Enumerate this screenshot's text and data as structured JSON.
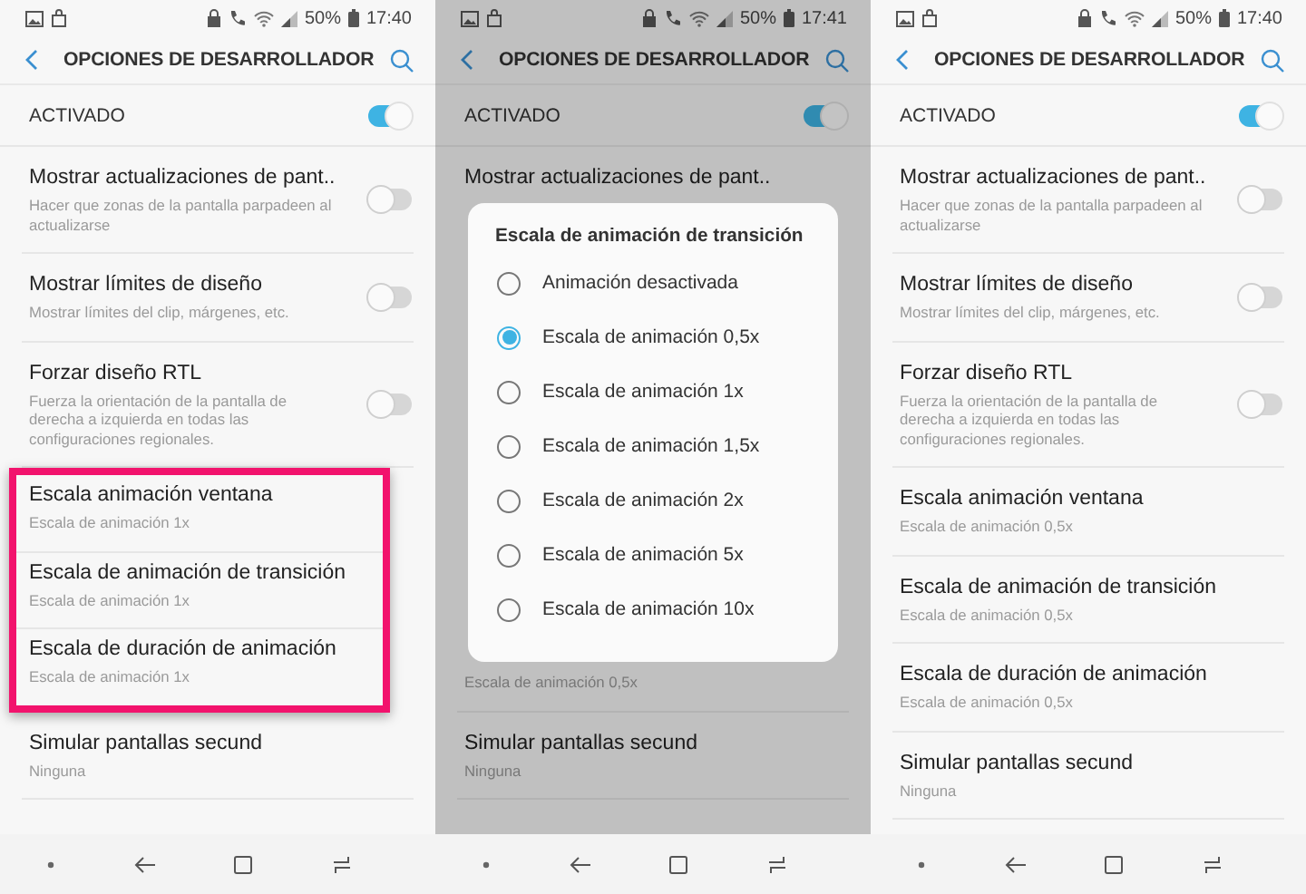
{
  "screens": [
    {
      "dimmed": false,
      "status_bar": {
        "battery": "50%",
        "time": "17:40"
      },
      "header": {
        "title": "OPCIONES DE DESARROLLADOR"
      },
      "master": {
        "label": "ACTIVADO",
        "on": true
      },
      "rows": [
        {
          "kind": "toggle",
          "title": "Mostrar actualizaciones de pant..",
          "subtitle": "Hacer que zonas de la pantalla parpadeen al actualizarse",
          "on": false,
          "highlighted": false
        },
        {
          "kind": "toggle",
          "title": "Mostrar límites de diseño",
          "subtitle": "Mostrar límites del clip, márgenes, etc.",
          "on": false,
          "highlighted": false
        },
        {
          "kind": "toggle",
          "title": "Forzar diseño RTL",
          "subtitle": "Fuerza la orientación de la pantalla de derecha a izquierda en todas las configuraciones regionales.",
          "on": false,
          "highlighted": false
        },
        {
          "kind": "text",
          "title": "Escala animación ventana",
          "subtitle": "Escala de animación 1x",
          "highlighted": true
        },
        {
          "kind": "text",
          "title": "Escala de animación de transición",
          "subtitle": "Escala de animación 1x",
          "highlighted": true
        },
        {
          "kind": "text",
          "title": "Escala de duración de animación",
          "subtitle": "Escala de animación 1x",
          "highlighted": true
        },
        {
          "kind": "text",
          "title": "Simular pantallas secund",
          "subtitle": "Ninguna",
          "highlighted": false
        }
      ]
    },
    {
      "dimmed": true,
      "status_bar": {
        "battery": "50%",
        "time": "17:41"
      },
      "header": {
        "title": "OPCIONES DE DESARROLLADOR"
      },
      "master": {
        "label": "ACTIVADO",
        "on": true
      },
      "rows": [
        {
          "title": "Mostrar actualizaciones de pant..",
          "highlighted": false
        }
      ],
      "dialog": {
        "title": "Escala de animación de transición",
        "options": [
          {
            "label": "Animación desactivada",
            "selected": false
          },
          {
            "label": "Escala de animación 0,5x",
            "selected": true
          },
          {
            "label": "Escala de animación 1x",
            "selected": false
          },
          {
            "label": "Escala de animación 1,5x",
            "selected": false
          },
          {
            "label": "Escala de animación 2x",
            "selected": false
          },
          {
            "label": "Escala de animación 5x",
            "selected": false
          },
          {
            "label": "Escala de animación 10x",
            "selected": false
          }
        ]
      },
      "rows_below": [
        {
          "subtitle": "Escala de animación 0,5x",
          "highlighted": false
        },
        {
          "title": "Simular pantallas secund",
          "subtitle": "Ninguna",
          "highlighted": false
        }
      ]
    },
    {
      "dimmed": false,
      "status_bar": {
        "battery": "50%",
        "time": "17:40"
      },
      "header": {
        "title": "OPCIONES DE DESARROLLADOR"
      },
      "master": {
        "label": "ACTIVADO",
        "on": true
      },
      "rows": [
        {
          "kind": "toggle",
          "title": "Mostrar actualizaciones de pant..",
          "subtitle": "Hacer que zonas de la pantalla parpadeen al actualizarse",
          "on": false,
          "highlighted": false
        },
        {
          "kind": "toggle",
          "title": "Mostrar límites de diseño",
          "subtitle": "Mostrar límites del clip, márgenes, etc.",
          "on": false,
          "highlighted": false
        },
        {
          "kind": "toggle",
          "title": "Forzar diseño RTL",
          "subtitle": "Fuerza la orientación de la pantalla de derecha a izquierda en todas las configuraciones regionales.",
          "on": false,
          "highlighted": false
        },
        {
          "kind": "text",
          "title": "Escala animación ventana",
          "subtitle": "Escala de animación 0,5x",
          "highlighted": false
        },
        {
          "kind": "text",
          "title": "Escala de animación de transición",
          "subtitle": "Escala de animación 0,5x",
          "highlighted": false
        },
        {
          "kind": "text",
          "title": "Escala de duración de animación",
          "subtitle": "Escala de animación 0,5x",
          "highlighted": false
        },
        {
          "kind": "text",
          "title": "Simular pantallas secund",
          "subtitle": "Ninguna",
          "highlighted": false
        }
      ]
    }
  ]
}
